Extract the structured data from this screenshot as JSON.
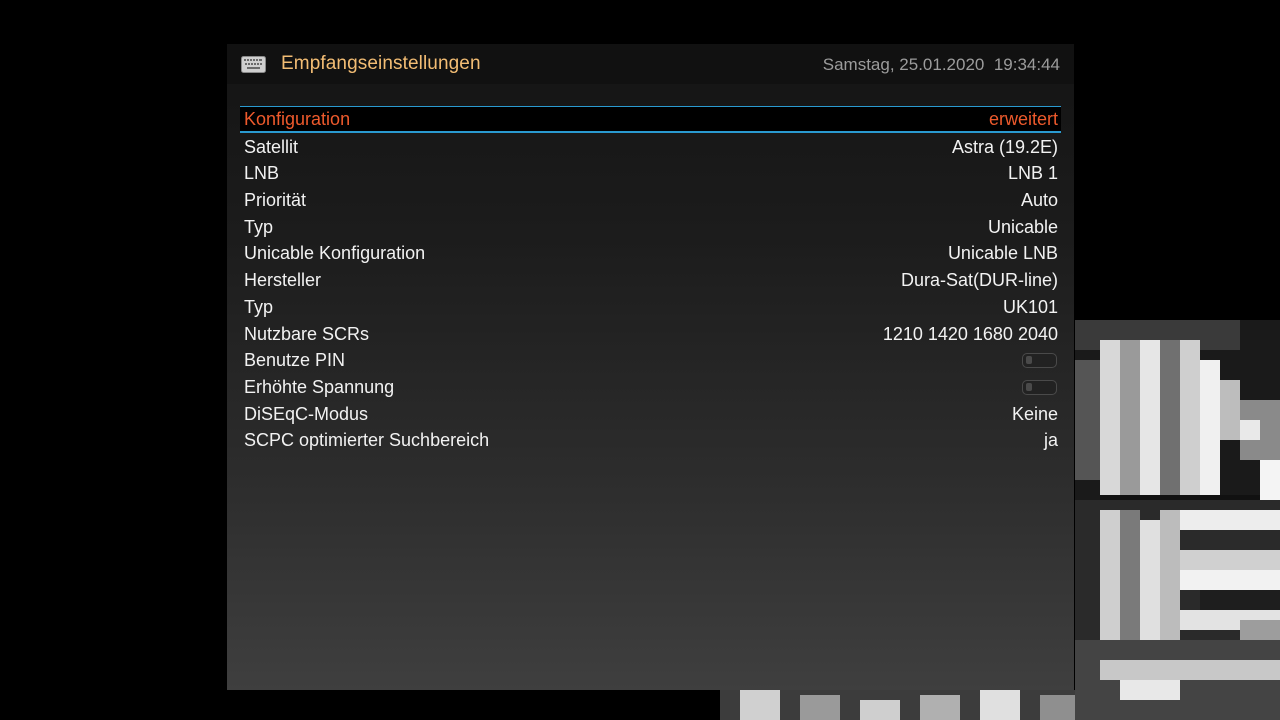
{
  "header": {
    "title": "Empfangseinstellungen",
    "datetime": "Samstag, 25.01.2020  19:34:44",
    "icon": "keyboard-icon"
  },
  "colors": {
    "title": "#f3bd74",
    "selected_text": "#ee5a2c",
    "selection_border": "#2a9ad0",
    "text": "#f2f2f2",
    "datetime": "#9c9c9c"
  },
  "settings": [
    {
      "label": "Konfiguration",
      "value": "erweitert",
      "selected": true
    },
    {
      "label": "Satellit",
      "value": "Astra (19.2E)"
    },
    {
      "label": "LNB",
      "value": "LNB 1"
    },
    {
      "label": "Priorität",
      "value": "Auto"
    },
    {
      "label": "Typ",
      "value": "Unicable"
    },
    {
      "label": "Unicable Konfiguration",
      "value": "Unicable LNB"
    },
    {
      "label": "Hersteller",
      "value": "Dura-Sat(DUR-line)"
    },
    {
      "label": "Typ",
      "value": "UK101"
    },
    {
      "label": "Nutzbare SCRs",
      "value": "1210 1420 1680 2040"
    },
    {
      "label": "Benutze PIN",
      "toggle": false
    },
    {
      "label": "Erhöhte Spannung",
      "toggle": false
    },
    {
      "label": "DiSEqC-Modus",
      "value": "Keine"
    },
    {
      "label": "SCPC optimierter Suchbereich",
      "value": "ja"
    }
  ]
}
